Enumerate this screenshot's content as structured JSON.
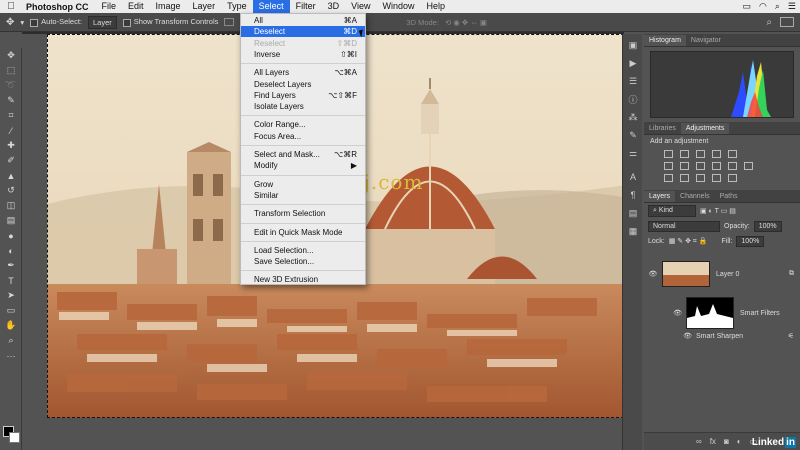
{
  "menubar": {
    "app_name": "Photoshop CC",
    "items": [
      "File",
      "Edit",
      "Image",
      "Layer",
      "Type",
      "Select",
      "Filter",
      "3D",
      "View",
      "Window",
      "Help"
    ],
    "active_item": "Select"
  },
  "options_bar": {
    "auto_select_label": "Auto-Select:",
    "auto_select_value": "Layer",
    "show_transform_label": "Show Transform Controls",
    "mode_3d_label": "3D Mode:"
  },
  "select_menu": {
    "groups": [
      [
        {
          "label": "All",
          "shortcut": "⌘A",
          "state": "normal"
        },
        {
          "label": "Deselect",
          "shortcut": "⌘D",
          "state": "highlighted"
        },
        {
          "label": "Reselect",
          "shortcut": "⇧⌘D",
          "state": "disabled"
        },
        {
          "label": "Inverse",
          "shortcut": "⇧⌘I",
          "state": "normal"
        }
      ],
      [
        {
          "label": "All Layers",
          "shortcut": "⌥⌘A",
          "state": "normal"
        },
        {
          "label": "Deselect Layers",
          "shortcut": "",
          "state": "normal"
        },
        {
          "label": "Find Layers",
          "shortcut": "⌥⇧⌘F",
          "state": "normal"
        },
        {
          "label": "Isolate Layers",
          "shortcut": "",
          "state": "normal"
        }
      ],
      [
        {
          "label": "Color Range...",
          "shortcut": "",
          "state": "normal"
        },
        {
          "label": "Focus Area...",
          "shortcut": "",
          "state": "normal"
        }
      ],
      [
        {
          "label": "Select and Mask...",
          "shortcut": "⌥⌘R",
          "state": "normal"
        },
        {
          "label": "Modify",
          "shortcut": "▶",
          "state": "normal"
        }
      ],
      [
        {
          "label": "Grow",
          "shortcut": "",
          "state": "normal"
        },
        {
          "label": "Similar",
          "shortcut": "",
          "state": "normal"
        }
      ],
      [
        {
          "label": "Transform Selection",
          "shortcut": "",
          "state": "normal"
        }
      ],
      [
        {
          "label": "Edit in Quick Mask Mode",
          "shortcut": "",
          "state": "normal"
        }
      ],
      [
        {
          "label": "Load Selection...",
          "shortcut": "",
          "state": "normal"
        },
        {
          "label": "Save Selection...",
          "shortcut": "",
          "state": "normal"
        }
      ],
      [
        {
          "label": "New 3D Extrusion",
          "shortcut": "",
          "state": "normal"
        }
      ]
    ]
  },
  "watermark": "www.cgtsj.com",
  "panels": {
    "top_tabs": [
      "Histogram",
      "Navigator"
    ],
    "top_active": "Histogram",
    "mid_tabs": [
      "Libraries",
      "Adjustments"
    ],
    "mid_active": "Adjustments",
    "adjustments_title": "Add an adjustment",
    "layer_tabs": [
      "Layers",
      "Channels",
      "Paths"
    ],
    "layer_active": "Layers",
    "kind_label": "Kind",
    "blend_mode": "Normal",
    "opacity_label": "Opacity:",
    "opacity_value": "100%",
    "lock_label": "Lock:",
    "fill_label": "Fill:",
    "fill_value": "100%",
    "layer_name": "Layer 0",
    "smart_filters_label": "Smart Filters",
    "smart_sharpen_label": "Smart Sharpen"
  },
  "colors": {
    "menu_highlight": "#2a6ee6",
    "foreground_swatch": "#000000",
    "background_swatch": "#ffffff"
  },
  "logo_text": "Linked in"
}
